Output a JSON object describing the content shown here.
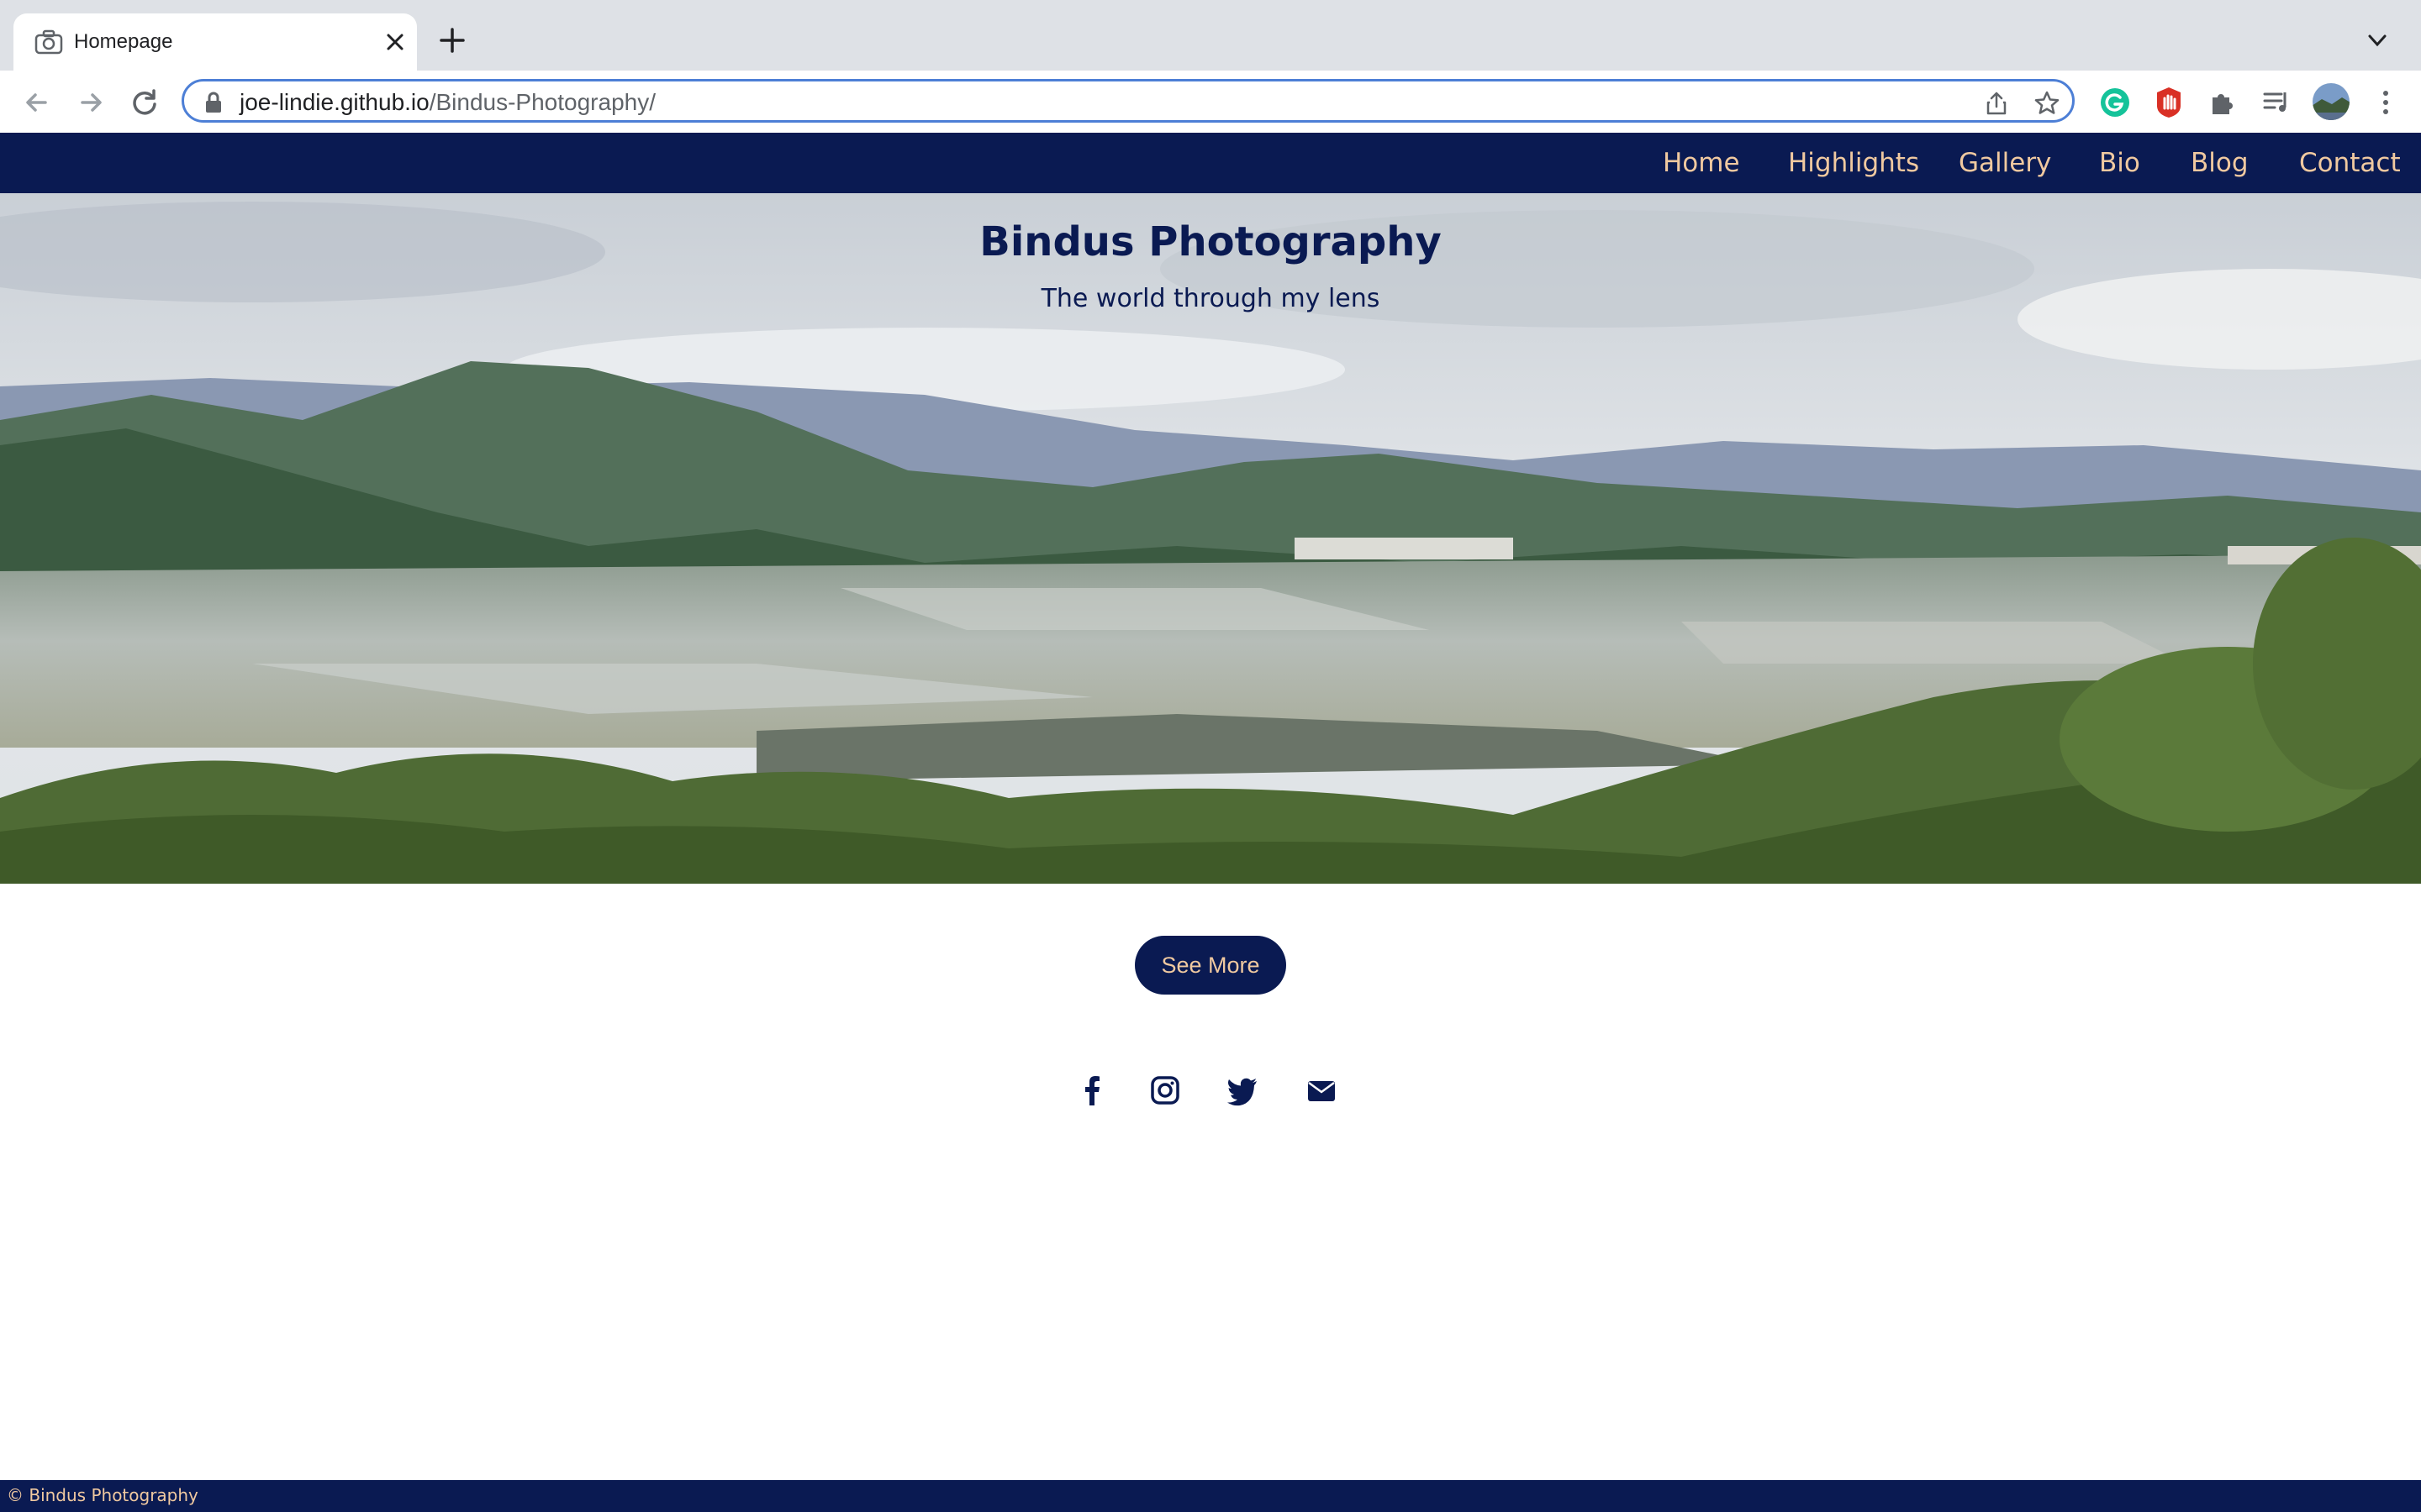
{
  "browser": {
    "tab_title": "Homepage",
    "url_domain": "joe-lindie.github.io",
    "url_path": "/Bindus-Photography/"
  },
  "nav": {
    "items": [
      "Home",
      "Highlights",
      "Gallery",
      "Bio",
      "Blog",
      "Contact"
    ]
  },
  "hero": {
    "title": "Bindus Photography",
    "subtitle": "The world through my lens"
  },
  "cta": {
    "label": "See More"
  },
  "social": {
    "icons": [
      "facebook-icon",
      "instagram-icon",
      "twitter-icon",
      "envelope-icon"
    ]
  },
  "footer": {
    "text": "© Bindus Photography"
  },
  "colors": {
    "navy": "#0a1a52",
    "peach": "#f0c9a0",
    "accent_blue": "#4d7fd6"
  }
}
